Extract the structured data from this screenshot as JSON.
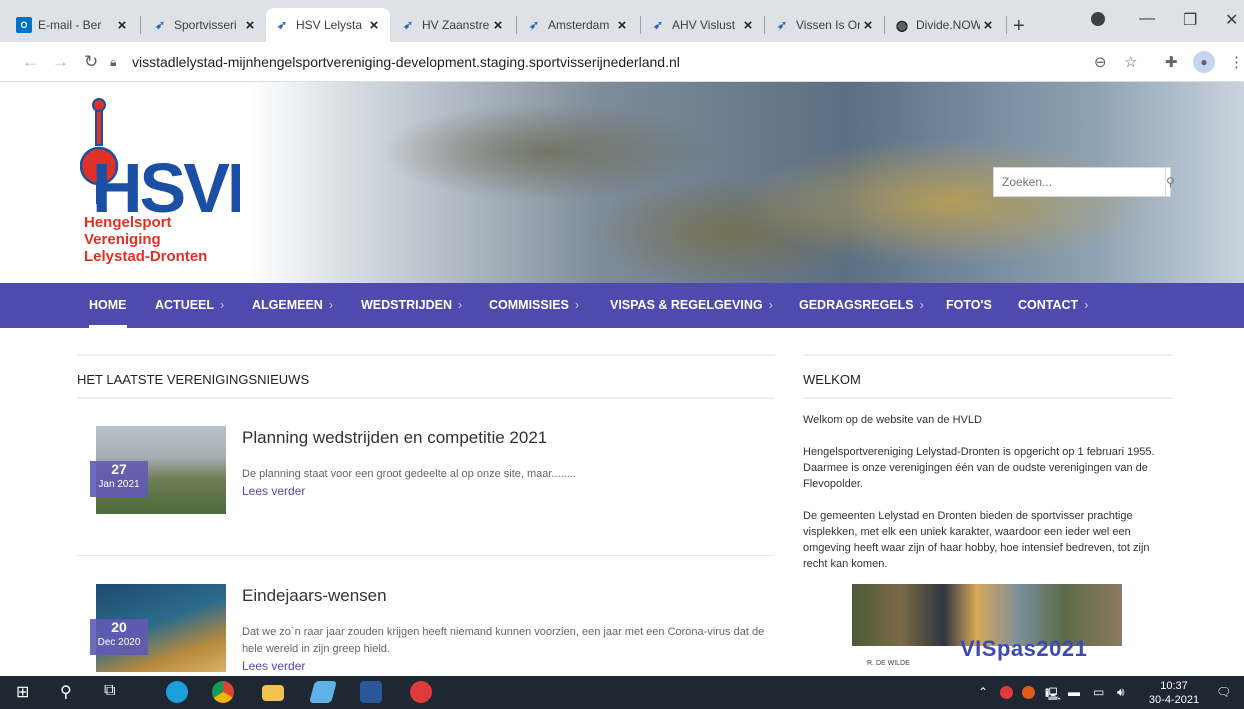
{
  "browser": {
    "tabs": [
      {
        "title": "E-mail - Ber",
        "icon": "outlook-icon"
      },
      {
        "title": "Sportvisseri",
        "icon": "fish-icon"
      },
      {
        "title": "HSV Lelysta",
        "icon": "fish-icon",
        "active": true
      },
      {
        "title": "HV Zaanstre",
        "icon": "fish-icon"
      },
      {
        "title": "Amsterdam",
        "icon": "fish-icon"
      },
      {
        "title": "AHV Vislust",
        "icon": "fish-icon"
      },
      {
        "title": "Vissen Is Or",
        "icon": "fish-icon"
      },
      {
        "title": "Divide.NOW",
        "icon": "globe-icon"
      }
    ],
    "url": "visstadlelystad-mijnhengelsportvereniging-development.staging.sportvisserijnederland.nl"
  },
  "site": {
    "logo": {
      "letters": "HSVL",
      "lines": [
        "Hengelsport",
        "Vereniging",
        "Lelystad-Dronten"
      ]
    },
    "search": {
      "placeholder": "Zoeken..."
    },
    "nav": [
      {
        "label": "HOME",
        "chevron": false
      },
      {
        "label": "ACTUEEL",
        "chevron": true
      },
      {
        "label": "ALGEMEEN",
        "chevron": true
      },
      {
        "label": "WEDSTRIJDEN",
        "chevron": true
      },
      {
        "label": "COMMISSIES",
        "chevron": true
      },
      {
        "label": "VISPAS & REGELGEVING",
        "chevron": true
      },
      {
        "label": "GEDRAGSREGELS",
        "chevron": true
      },
      {
        "label": "FOTO'S",
        "chevron": false
      },
      {
        "label": "CONTACT",
        "chevron": true
      }
    ],
    "news_heading": "HET LAATSTE VERENIGINGSNIEUWS",
    "news": [
      {
        "day": "27",
        "month": "Jan 2021",
        "title": "Planning wedstrijden en competitie 2021",
        "excerpt": "De planning staat voor een groot gedeelte al op onze site, maar........",
        "more": "Lees verder"
      },
      {
        "day": "20",
        "month": "Dec 2020",
        "title": "Eindejaars-wensen",
        "excerpt": "Dat we zo`n raar jaar zouden krijgen heeft niemand kunnen voorzien, een jaar met een Corona-virus dat de hele wereld in zijn greep hield.",
        "more": "Lees verder"
      }
    ],
    "welkom_heading": "WELKOM",
    "welkom": {
      "p1": "Welkom op de website van de HVLD",
      "p2": "Hengelsportvereniging Lelystad-Dronten is opgericht op 1 februari 1955. Daarmee is onze verenigingen één van de oudste verenigingen van de Flevopolder.",
      "p3": "De gemeenten Lelystad en Dronten bieden de sportvisser prachtige visplekken, met elk een uniek karakter, waardoor een ieder wel een omgeving heeft waar zijn of haar hobby, hoe intensief bedreven, tot zijn recht kan komen."
    },
    "vispas": {
      "title": "VISpas2021",
      "sub": "R. DE WILDE"
    }
  },
  "taskbar": {
    "time": "10:37",
    "date": "30-4-2021"
  },
  "colors": {
    "nav_bg": "#4f4aae",
    "brand_red": "#e03127",
    "brand_blue": "#1a4fa3",
    "link": "#4f4aae"
  }
}
